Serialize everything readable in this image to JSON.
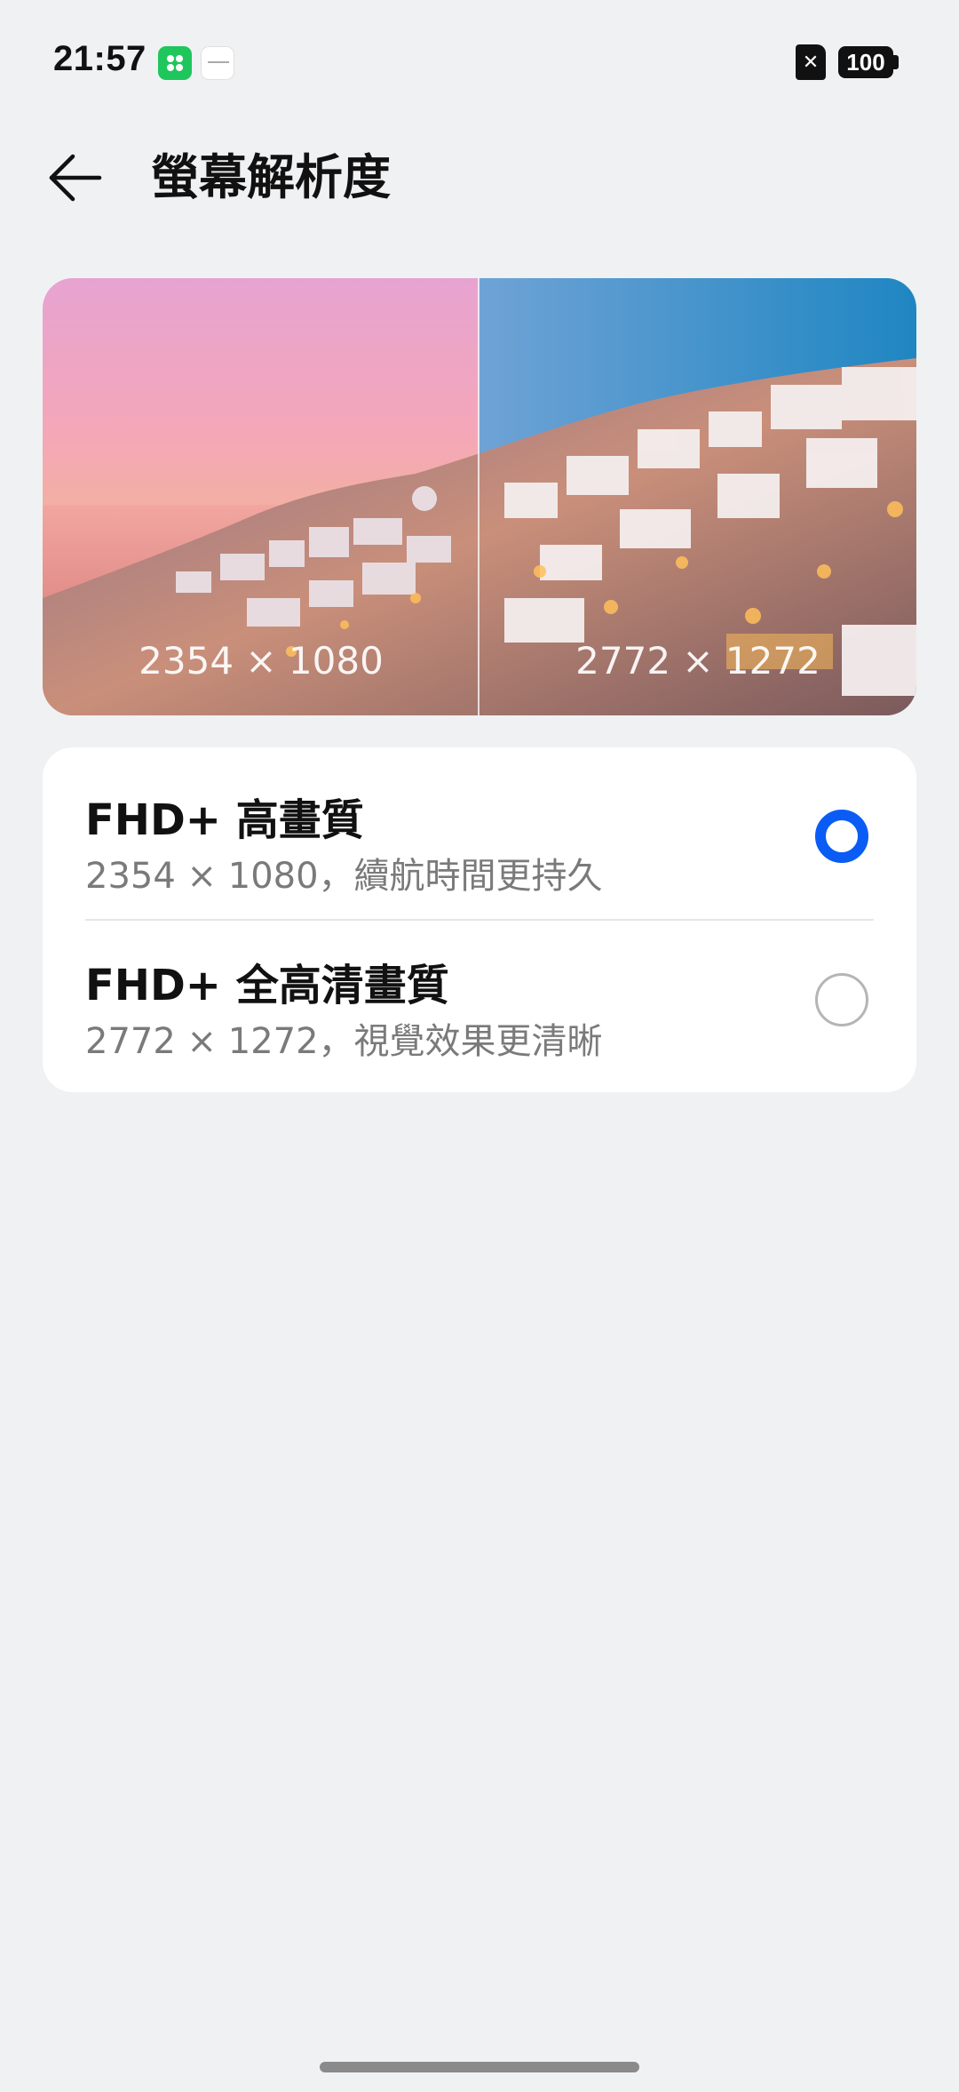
{
  "status_bar": {
    "time": "21:57",
    "battery": "100",
    "sim_icon": "✕"
  },
  "header": {
    "title": "螢幕解析度"
  },
  "preview": {
    "left_label": "2354 × 1080",
    "right_label": "2772 × 1272"
  },
  "options": [
    {
      "title": "FHD+ 高畫質",
      "subtitle": "2354 × 1080，續航時間更持久",
      "selected": true
    },
    {
      "title": "FHD+ 全高清畫質",
      "subtitle": "2772 × 1272，視覺效果更清晰",
      "selected": false
    }
  ],
  "colors": {
    "accent": "#0a5cf5",
    "background": "#f0f1f3",
    "card": "#ffffff"
  }
}
